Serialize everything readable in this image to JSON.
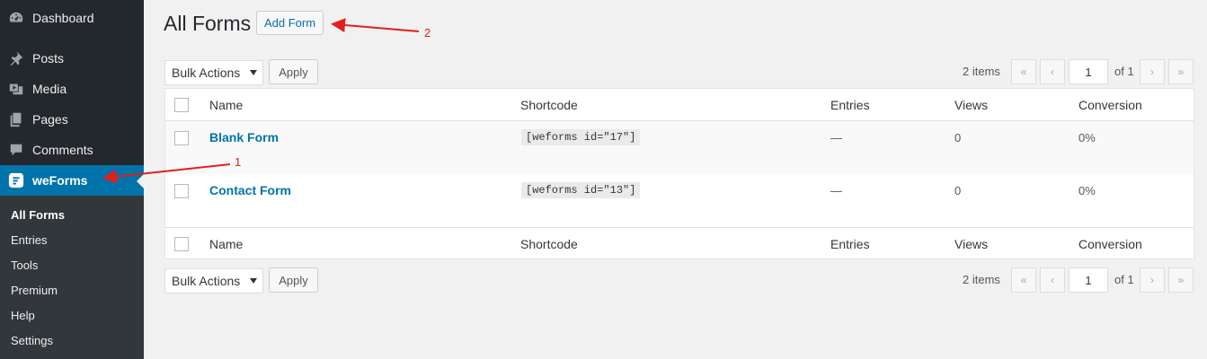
{
  "sidebar": {
    "menu": [
      {
        "label": "Dashboard",
        "icon": "dashboard-icon"
      },
      {
        "label": "Posts",
        "icon": "pin-icon"
      },
      {
        "label": "Media",
        "icon": "media-icon"
      },
      {
        "label": "Pages",
        "icon": "pages-icon"
      },
      {
        "label": "Comments",
        "icon": "comment-icon"
      },
      {
        "label": "weForms",
        "icon": "weforms-icon"
      }
    ],
    "submenu": [
      "All Forms",
      "Entries",
      "Tools",
      "Premium",
      "Help",
      "Settings"
    ]
  },
  "header": {
    "title": "All Forms",
    "add_button": "Add Form"
  },
  "bulk": {
    "label": "Bulk Actions",
    "apply": "Apply"
  },
  "pagination": {
    "count": "2 items",
    "first": "«",
    "prev": "‹",
    "page": "1",
    "of": "of 1",
    "next": "›",
    "last": "»"
  },
  "table": {
    "columns": [
      "Name",
      "Shortcode",
      "Entries",
      "Views",
      "Conversion"
    ],
    "rows": [
      {
        "name": "Blank Form",
        "shortcode": "[weforms id=\"17\"]",
        "entries": "—",
        "views": "0",
        "conversion": "0%"
      },
      {
        "name": "Contact Form",
        "shortcode": "[weforms id=\"13\"]",
        "entries": "—",
        "views": "0",
        "conversion": "0%"
      }
    ]
  },
  "annotations": {
    "one": "1",
    "two": "2"
  },
  "colors": {
    "accent": "#0073aa",
    "sidebar": "#23282d",
    "annotation": "#e0201c"
  }
}
